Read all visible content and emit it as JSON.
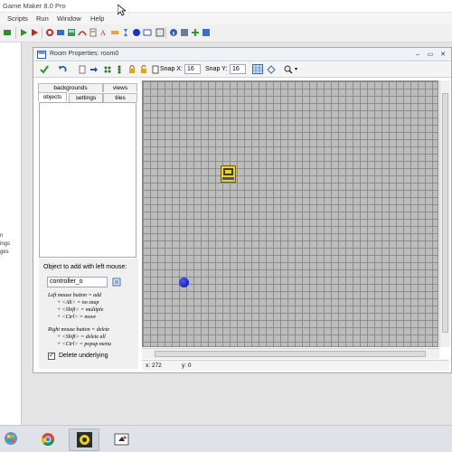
{
  "app": {
    "title": "Game Maker 8.0 Pro",
    "menu": [
      "Scripts",
      "Run",
      "Window",
      "Help"
    ]
  },
  "left_panel": {
    "items": [
      "n",
      "ings",
      "ges"
    ]
  },
  "room_window": {
    "title": "Room Properties: room0",
    "snap_x_label": "Snap X:",
    "snap_x_value": "16",
    "snap_y_label": "Snap Y:",
    "snap_y_value": "16",
    "tabs_back": [
      "backgrounds",
      "views"
    ],
    "tabs_front": [
      "objects",
      "settings",
      "tiles"
    ],
    "active_tab": "objects",
    "object_panel": {
      "label": "Object to add with left mouse:",
      "selected_object": "controller_o",
      "help_lines": [
        "Left mouse button = add",
        "+ <Alt> = no snap",
        "+ <Shift> = multiple",
        "+ <Ctrl> = move",
        "Right mouse button = delete",
        "+ <Shift> = delete all",
        "+ <Ctrl> = popup menu"
      ],
      "delete_underlying_label": "Delete underlying",
      "delete_underlying_checked": true
    },
    "status": {
      "x": "x: 272",
      "y": "y: 0"
    }
  },
  "colors": {
    "accent": "#316ac5",
    "grid_bg": "#bdbdbd",
    "grid_line": "#8c8c8c",
    "ball": "#1a1aa8"
  },
  "taskbar": {
    "items": [
      "start-orb-icon",
      "explorer-icon",
      "chrome-icon",
      "game-maker-icon",
      "game-window-icon"
    ],
    "active": "game-maker-icon"
  }
}
